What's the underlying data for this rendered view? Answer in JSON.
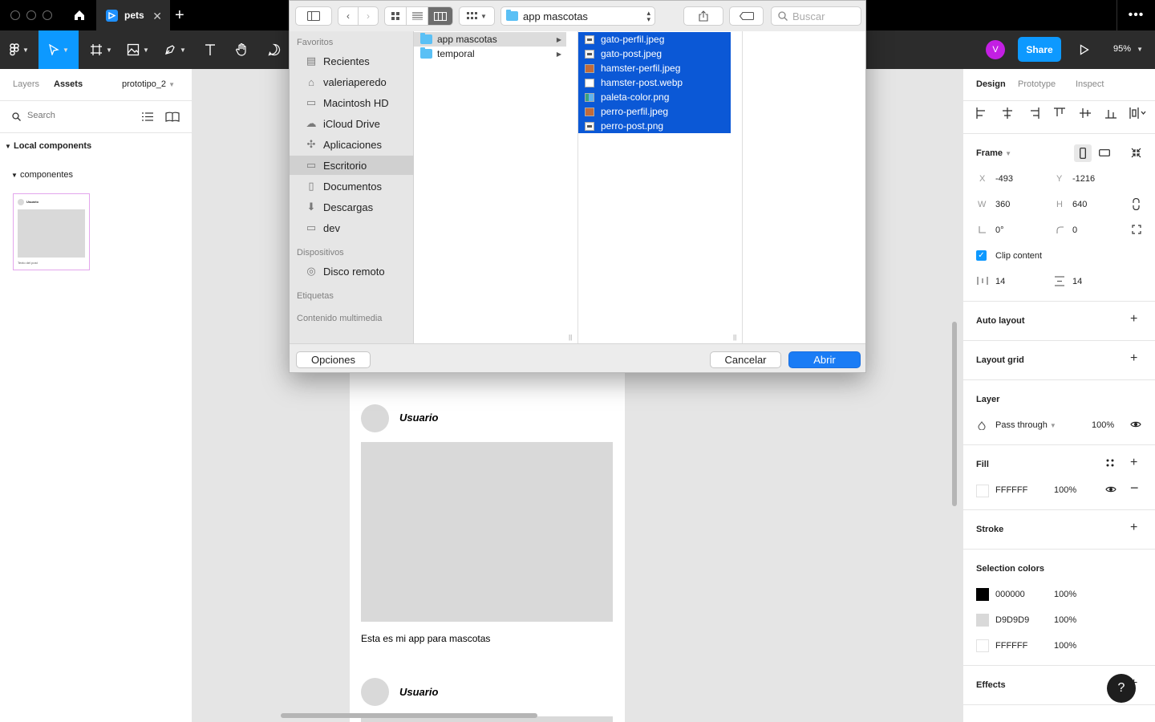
{
  "tab": {
    "title": "pets"
  },
  "toolbar": {
    "avatar_letter": "V",
    "share_label": "Share",
    "zoom": "95%"
  },
  "left_panel": {
    "tabs": [
      "Layers",
      "Assets"
    ],
    "page": "prototipo_2",
    "search_placeholder": "Search",
    "section": "Local components",
    "subsection": "componentes",
    "thumb_user": "Usuario",
    "thumb_caption": "Texto del post"
  },
  "canvas": {
    "posts": [
      {
        "user": "Usuario",
        "caption": "Esta es mi app para mascotas"
      },
      {
        "user": "Usuario"
      }
    ]
  },
  "right_panel": {
    "tabs": [
      "Design",
      "Prototype",
      "Inspect"
    ],
    "frame": {
      "label": "Frame",
      "x_label": "X",
      "x": "-493",
      "y_label": "Y",
      "y": "-1216",
      "w_label": "W",
      "w": "360",
      "h_label": "H",
      "h": "640",
      "rotation": "0°",
      "radius": "0",
      "clip_label": "Clip content",
      "gap_h": "14",
      "gap_v": "14"
    },
    "auto_layout": "Auto layout",
    "layout_grid": "Layout grid",
    "layer": {
      "label": "Layer",
      "blend": "Pass through",
      "opacity": "100%"
    },
    "fill": {
      "label": "Fill",
      "hex": "FFFFFF",
      "opacity": "100%",
      "color": "#FFFFFF"
    },
    "stroke": "Stroke",
    "selection_colors": {
      "label": "Selection colors",
      "items": [
        {
          "hex": "000000",
          "opacity": "100%",
          "color": "#000000"
        },
        {
          "hex": "D9D9D9",
          "opacity": "100%",
          "color": "#D9D9D9"
        },
        {
          "hex": "FFFFFF",
          "opacity": "100%",
          "color": "#FFFFFF"
        }
      ]
    },
    "effects": "Effects"
  },
  "dialog": {
    "path": "app mascotas",
    "search_placeholder": "Buscar",
    "sidebar": {
      "favorites_label": "Favoritos",
      "favorites": [
        "Recientes",
        "valeriaperedo",
        "Macintosh HD",
        "iCloud Drive",
        "Aplicaciones",
        "Escritorio",
        "Documentos",
        "Descargas",
        "dev"
      ],
      "devices_label": "Dispositivos",
      "devices": [
        "Disco remoto"
      ],
      "tags_label": "Etiquetas",
      "media_label": "Contenido multimedia"
    },
    "column1": [
      "app mascotas",
      "temporal"
    ],
    "column2": [
      "gato-perfil.jpeg",
      "gato-post.jpeg",
      "hamster-perfil.jpeg",
      "hamster-post.webp",
      "paleta-color.png",
      "perro-perfil.jpeg",
      "perro-post.png"
    ],
    "options_label": "Opciones",
    "cancel_label": "Cancelar",
    "open_label": "Abrir"
  },
  "help": "?"
}
